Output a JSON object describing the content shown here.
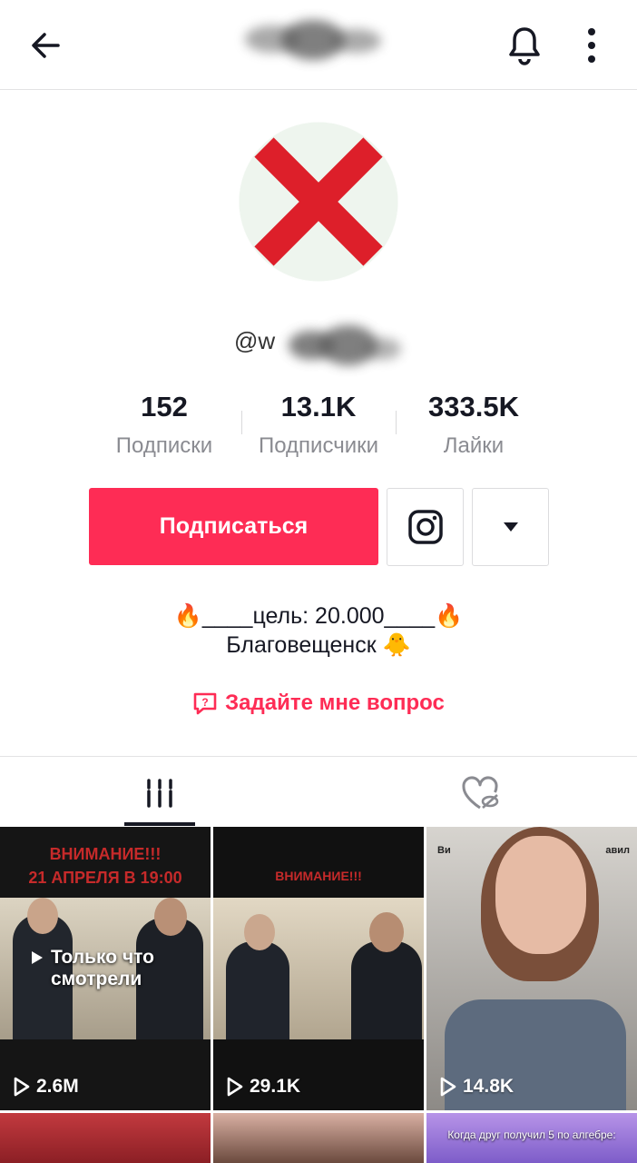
{
  "header": {
    "back_icon": "arrow-left-icon",
    "bell_icon": "bell-icon",
    "more_icon": "more-vertical-icon"
  },
  "profile": {
    "handle": "@w"
  },
  "stats": [
    {
      "value": "152",
      "label": "Подписки"
    },
    {
      "value": "13.1K",
      "label": "Подписчики"
    },
    {
      "value": "333.5K",
      "label": "Лайки"
    }
  ],
  "actions": {
    "follow_label": "Подписаться",
    "instagram_icon": "instagram-icon",
    "dropdown_icon": "triangle-down-icon"
  },
  "bio": {
    "line1": "🔥____цель: 20.000____🔥",
    "line2": "Благовещенск 🐥"
  },
  "ask": {
    "label": "Задайте мне вопрос"
  },
  "tabs": [
    {
      "icon": "grid-icon"
    },
    {
      "icon": "liked-hidden-icon"
    }
  ],
  "videos": [
    {
      "banner_top": "ВНИМАНИЕ!!!",
      "banner_bottom": "21 АПРЕЛЯ В 19:00",
      "overlay": "Только что смотрели",
      "views": "2.6M"
    },
    {
      "banner_top": "ВНИМАНИЕ!!!",
      "views": "29.1K"
    },
    {
      "caption_left": "Ви",
      "caption_right": "авил",
      "views": "14.8K"
    },
    {},
    {},
    {
      "caption": "Когда друг получил 5 по алгебре:"
    }
  ],
  "colors": {
    "accent": "#fe2c55",
    "text": "#161823",
    "muted": "#8a8b91"
  }
}
